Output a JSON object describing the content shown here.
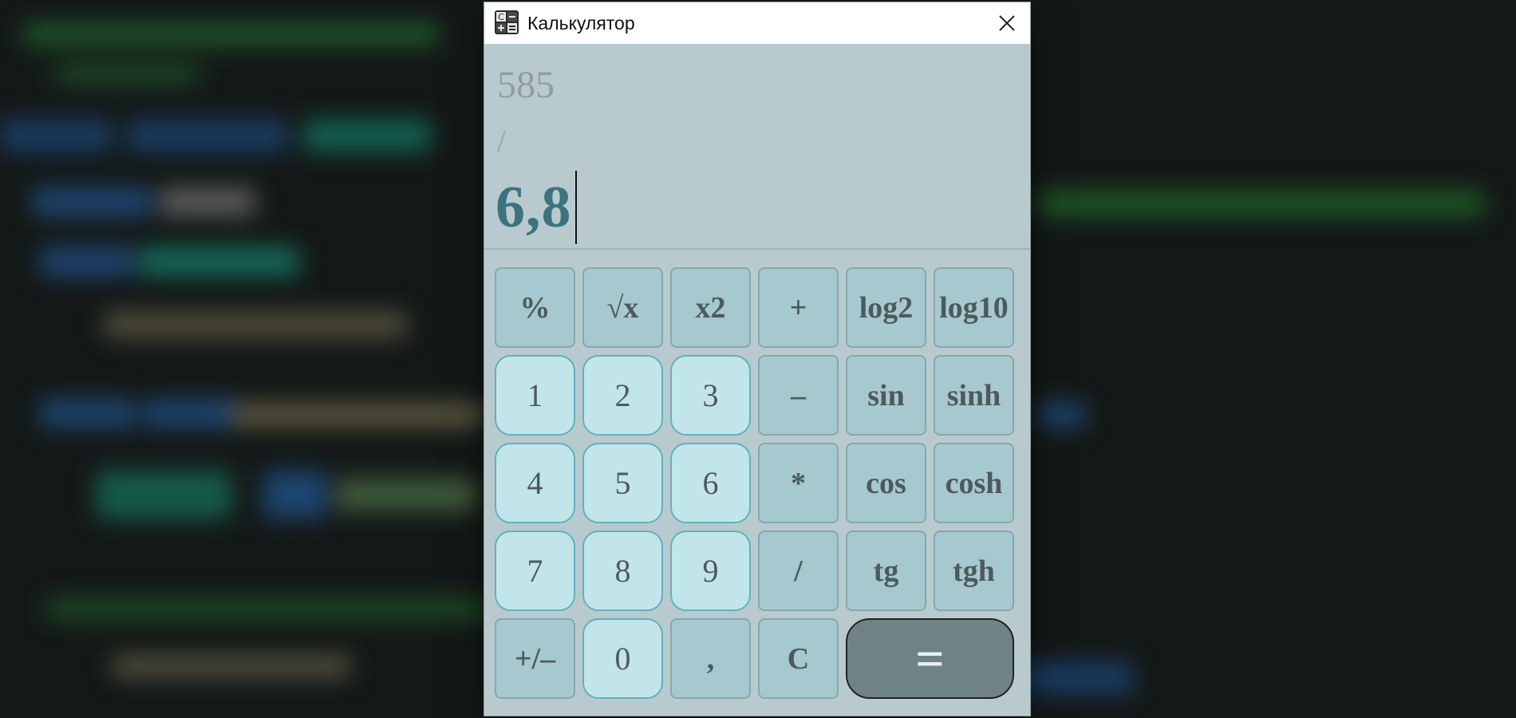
{
  "window": {
    "title": "Калькулятор",
    "close_icon": "close-icon",
    "app_icon": "calculator-icon"
  },
  "display": {
    "previous_operand": "585",
    "operator": "/",
    "current_value": "6,8"
  },
  "keypad": {
    "rows": [
      [
        {
          "label": "%",
          "kind": "func",
          "name": "percent-button"
        },
        {
          "label": "√x",
          "kind": "func",
          "name": "sqrt-button"
        },
        {
          "label": "x2",
          "kind": "func",
          "name": "square-button"
        },
        {
          "label": "+",
          "kind": "func",
          "name": "plus-button"
        },
        {
          "label": "log2",
          "kind": "func",
          "name": "log2-button"
        },
        {
          "label": "log10",
          "kind": "func",
          "name": "log10-button"
        }
      ],
      [
        {
          "label": "1",
          "kind": "digit",
          "name": "digit-1-button"
        },
        {
          "label": "2",
          "kind": "digit",
          "name": "digit-2-button"
        },
        {
          "label": "3",
          "kind": "digit",
          "name": "digit-3-button"
        },
        {
          "label": "–",
          "kind": "func",
          "name": "minus-button"
        },
        {
          "label": "sin",
          "kind": "func",
          "name": "sin-button"
        },
        {
          "label": "sinh",
          "kind": "func",
          "name": "sinh-button"
        }
      ],
      [
        {
          "label": "4",
          "kind": "digit",
          "name": "digit-4-button"
        },
        {
          "label": "5",
          "kind": "digit",
          "name": "digit-5-button"
        },
        {
          "label": "6",
          "kind": "digit",
          "name": "digit-6-button"
        },
        {
          "label": "*",
          "kind": "func",
          "name": "multiply-button"
        },
        {
          "label": "cos",
          "kind": "func",
          "name": "cos-button"
        },
        {
          "label": "cosh",
          "kind": "func",
          "name": "cosh-button"
        }
      ],
      [
        {
          "label": "7",
          "kind": "digit",
          "name": "digit-7-button"
        },
        {
          "label": "8",
          "kind": "digit",
          "name": "digit-8-button"
        },
        {
          "label": "9",
          "kind": "digit",
          "name": "digit-9-button"
        },
        {
          "label": "/",
          "kind": "func",
          "name": "divide-button"
        },
        {
          "label": "tg",
          "kind": "func",
          "name": "tg-button"
        },
        {
          "label": "tgh",
          "kind": "func",
          "name": "tgh-button"
        }
      ],
      [
        {
          "label": "+/–",
          "kind": "func",
          "name": "negate-button"
        },
        {
          "label": "0",
          "kind": "digit",
          "name": "digit-0-button"
        },
        {
          "label": ",",
          "kind": "func",
          "name": "decimal-button"
        },
        {
          "label": "C",
          "kind": "func",
          "name": "clear-button"
        },
        {
          "label": "=",
          "kind": "equals",
          "name": "equals-button"
        }
      ]
    ]
  },
  "colors": {
    "display_bg": "#b9cacf",
    "current_value": "#3d7380",
    "func_key": "#a6c8cf",
    "digit_key": "#c2e5ea",
    "equals_key": "#6f8386"
  }
}
